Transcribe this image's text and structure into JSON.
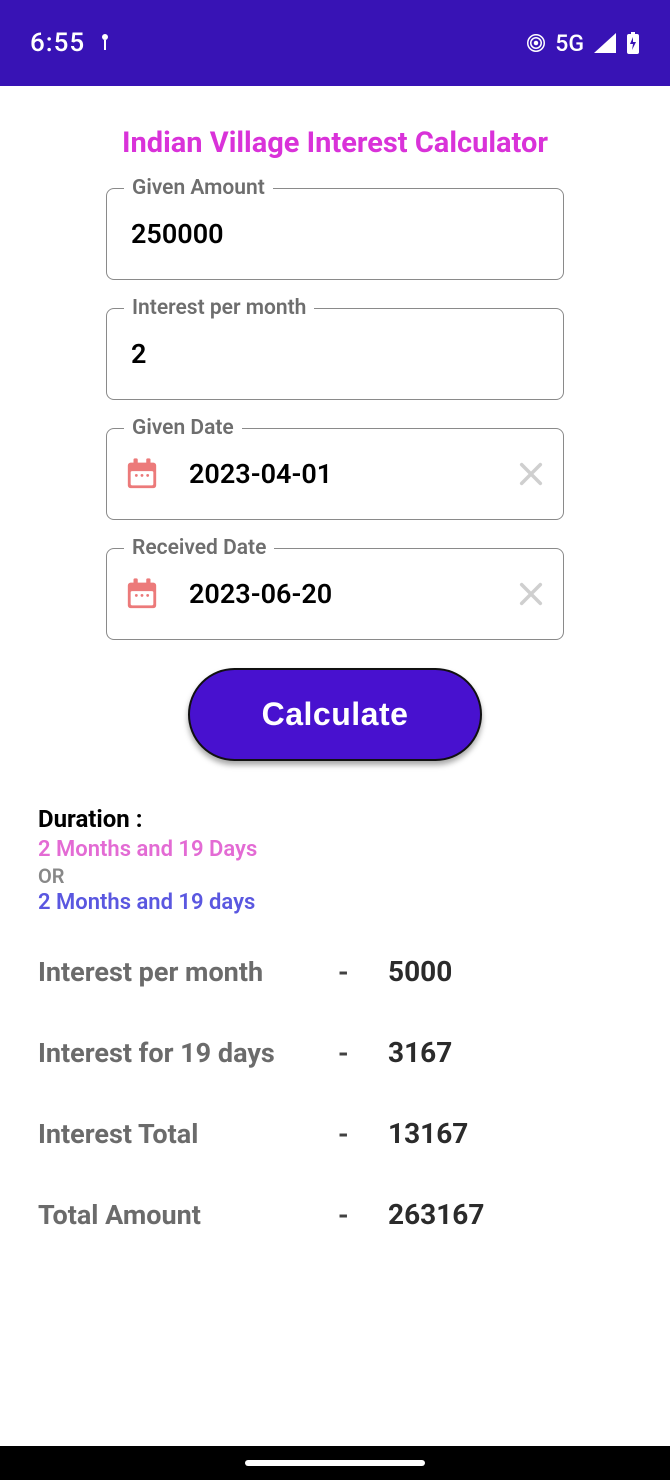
{
  "status": {
    "time": "6:55",
    "network": "5G"
  },
  "title": "Indian Village Interest Calculator",
  "fields": {
    "amount": {
      "label": "Given Amount",
      "value": "250000"
    },
    "rate": {
      "label": "Interest per month",
      "value": "2"
    },
    "given_date": {
      "label": "Given Date",
      "value": "2023-04-01"
    },
    "received_date": {
      "label": "Received Date",
      "value": "2023-06-20"
    }
  },
  "button": {
    "label": "Calculate"
  },
  "duration": {
    "title": "Duration :",
    "line1": "2  Months and 19  Days",
    "or": "OR",
    "line2": "2  Months and 19  days"
  },
  "results": {
    "r1": {
      "label": "Interest per month",
      "value": "5000"
    },
    "r2": {
      "label": "Interest for 19 days",
      "value": "3167"
    },
    "r3": {
      "label": "Interest Total",
      "value": "13167"
    },
    "r4": {
      "label": "Total Amount",
      "value": "263167"
    }
  }
}
